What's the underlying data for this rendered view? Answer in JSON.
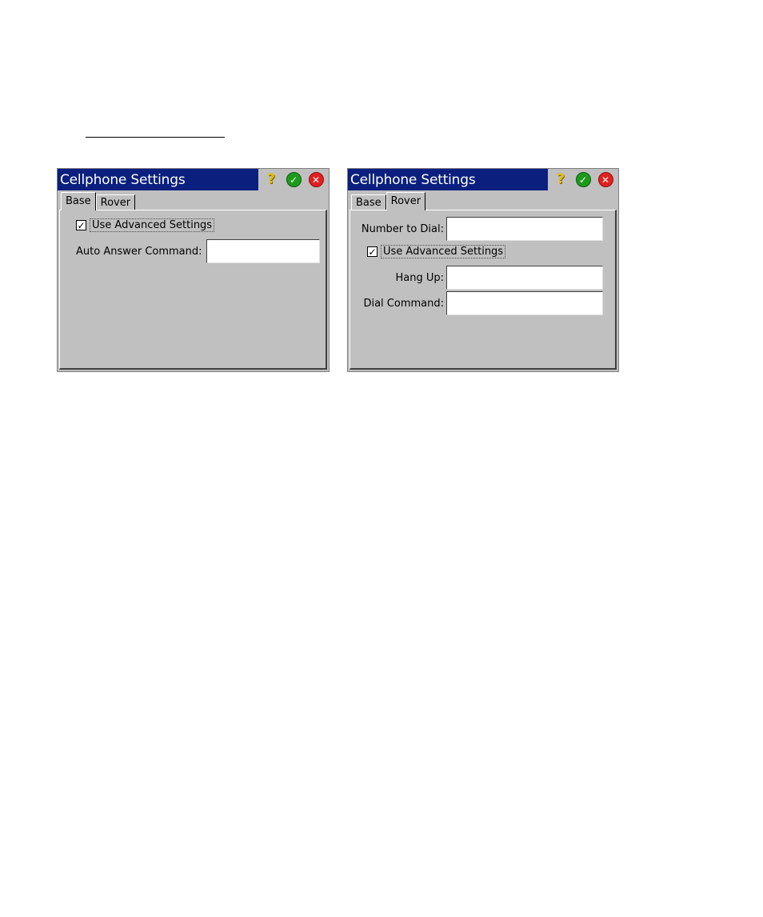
{
  "dialogs": [
    {
      "title": "Cellphone Settings",
      "tabs": [
        {
          "label": "Base",
          "active": true
        },
        {
          "label": "Rover",
          "active": false
        }
      ],
      "use_advanced_label": "Use Advanced Settings",
      "use_advanced_checked": true,
      "auto_answer_label": "Auto Answer Command:",
      "auto_answer_value": ""
    },
    {
      "title": "Cellphone Settings",
      "tabs": [
        {
          "label": "Base",
          "active": false
        },
        {
          "label": "Rover",
          "active": true
        }
      ],
      "number_to_dial_label": "Number to Dial:",
      "number_to_dial_value": "",
      "use_advanced_label": "Use Advanced Settings",
      "use_advanced_checked": true,
      "hang_up_label": "Hang Up:",
      "hang_up_value": "",
      "dial_command_label": "Dial Command:",
      "dial_command_value": ""
    }
  ],
  "icons": {
    "help": "question-mark-icon",
    "ok": "checkmark-icon",
    "close": "close-icon",
    "check": "✓"
  },
  "colors": {
    "titlebar": "#0a1f7e",
    "window": "#c0c0c0",
    "ok": "#1c9a1c",
    "cancel": "#e02020",
    "help": "#e0c000"
  }
}
